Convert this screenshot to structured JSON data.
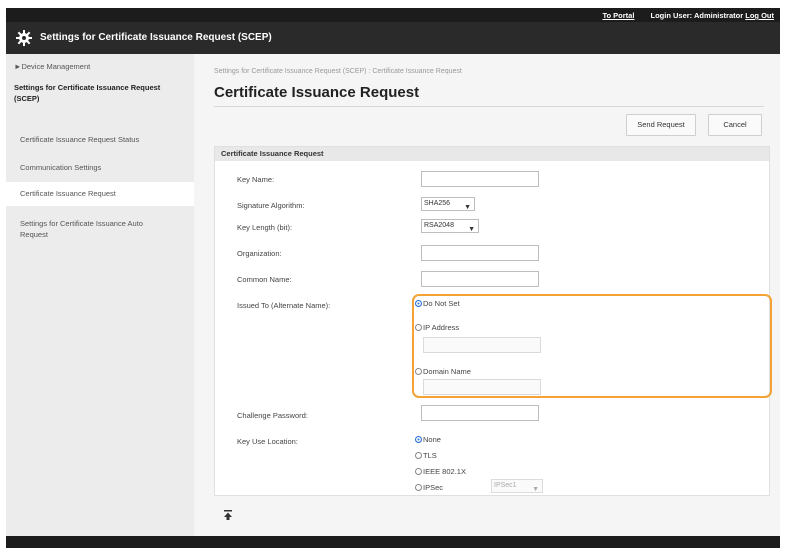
{
  "top_links": {
    "portal": "To Portal",
    "login_user": "Login User: Administrator",
    "logout": "Log Out"
  },
  "app_title": "Settings for Certificate Issuance Request (SCEP)",
  "sidebar": {
    "device_management": "Device Management",
    "current_section": "Settings for Certificate Issuance Request (SCEP)",
    "items": [
      {
        "label": "Certificate Issuance Request Status"
      },
      {
        "label": "Communication Settings"
      },
      {
        "label": "Certificate Issuance Request"
      },
      {
        "label": "Settings for Certificate Issuance Auto Request"
      }
    ]
  },
  "breadcrumb": "Settings for Certificate Issuance Request (SCEP) : Certificate Issuance Request",
  "page_title": "Certificate Issuance Request",
  "buttons": {
    "send": "Send Request",
    "cancel": "Cancel"
  },
  "panel_title": "Certificate Issuance Request",
  "form": {
    "key_name": {
      "label": "Key Name:",
      "value": ""
    },
    "signature_algorithm": {
      "label": "Signature Algorithm:",
      "value": "SHA256"
    },
    "key_length": {
      "label": "Key Length (bit):",
      "value": "RSA2048"
    },
    "organization": {
      "label": "Organization:",
      "value": ""
    },
    "common_name": {
      "label": "Common Name:",
      "value": ""
    },
    "issued_to": {
      "label": "Issued To (Alternate Name):",
      "options": [
        "Do Not Set",
        "IP Address",
        "Domain Name"
      ],
      "selected": "Do Not Set"
    },
    "challenge_password": {
      "label": "Challenge Password:",
      "value": ""
    },
    "key_use_location": {
      "label": "Key Use Location:",
      "options": [
        "None",
        "TLS",
        "IEEE 802.1X",
        "IPSec"
      ],
      "selected": "None",
      "ipsec_select": "IPSec1"
    }
  },
  "accent_color": "#f3a233"
}
